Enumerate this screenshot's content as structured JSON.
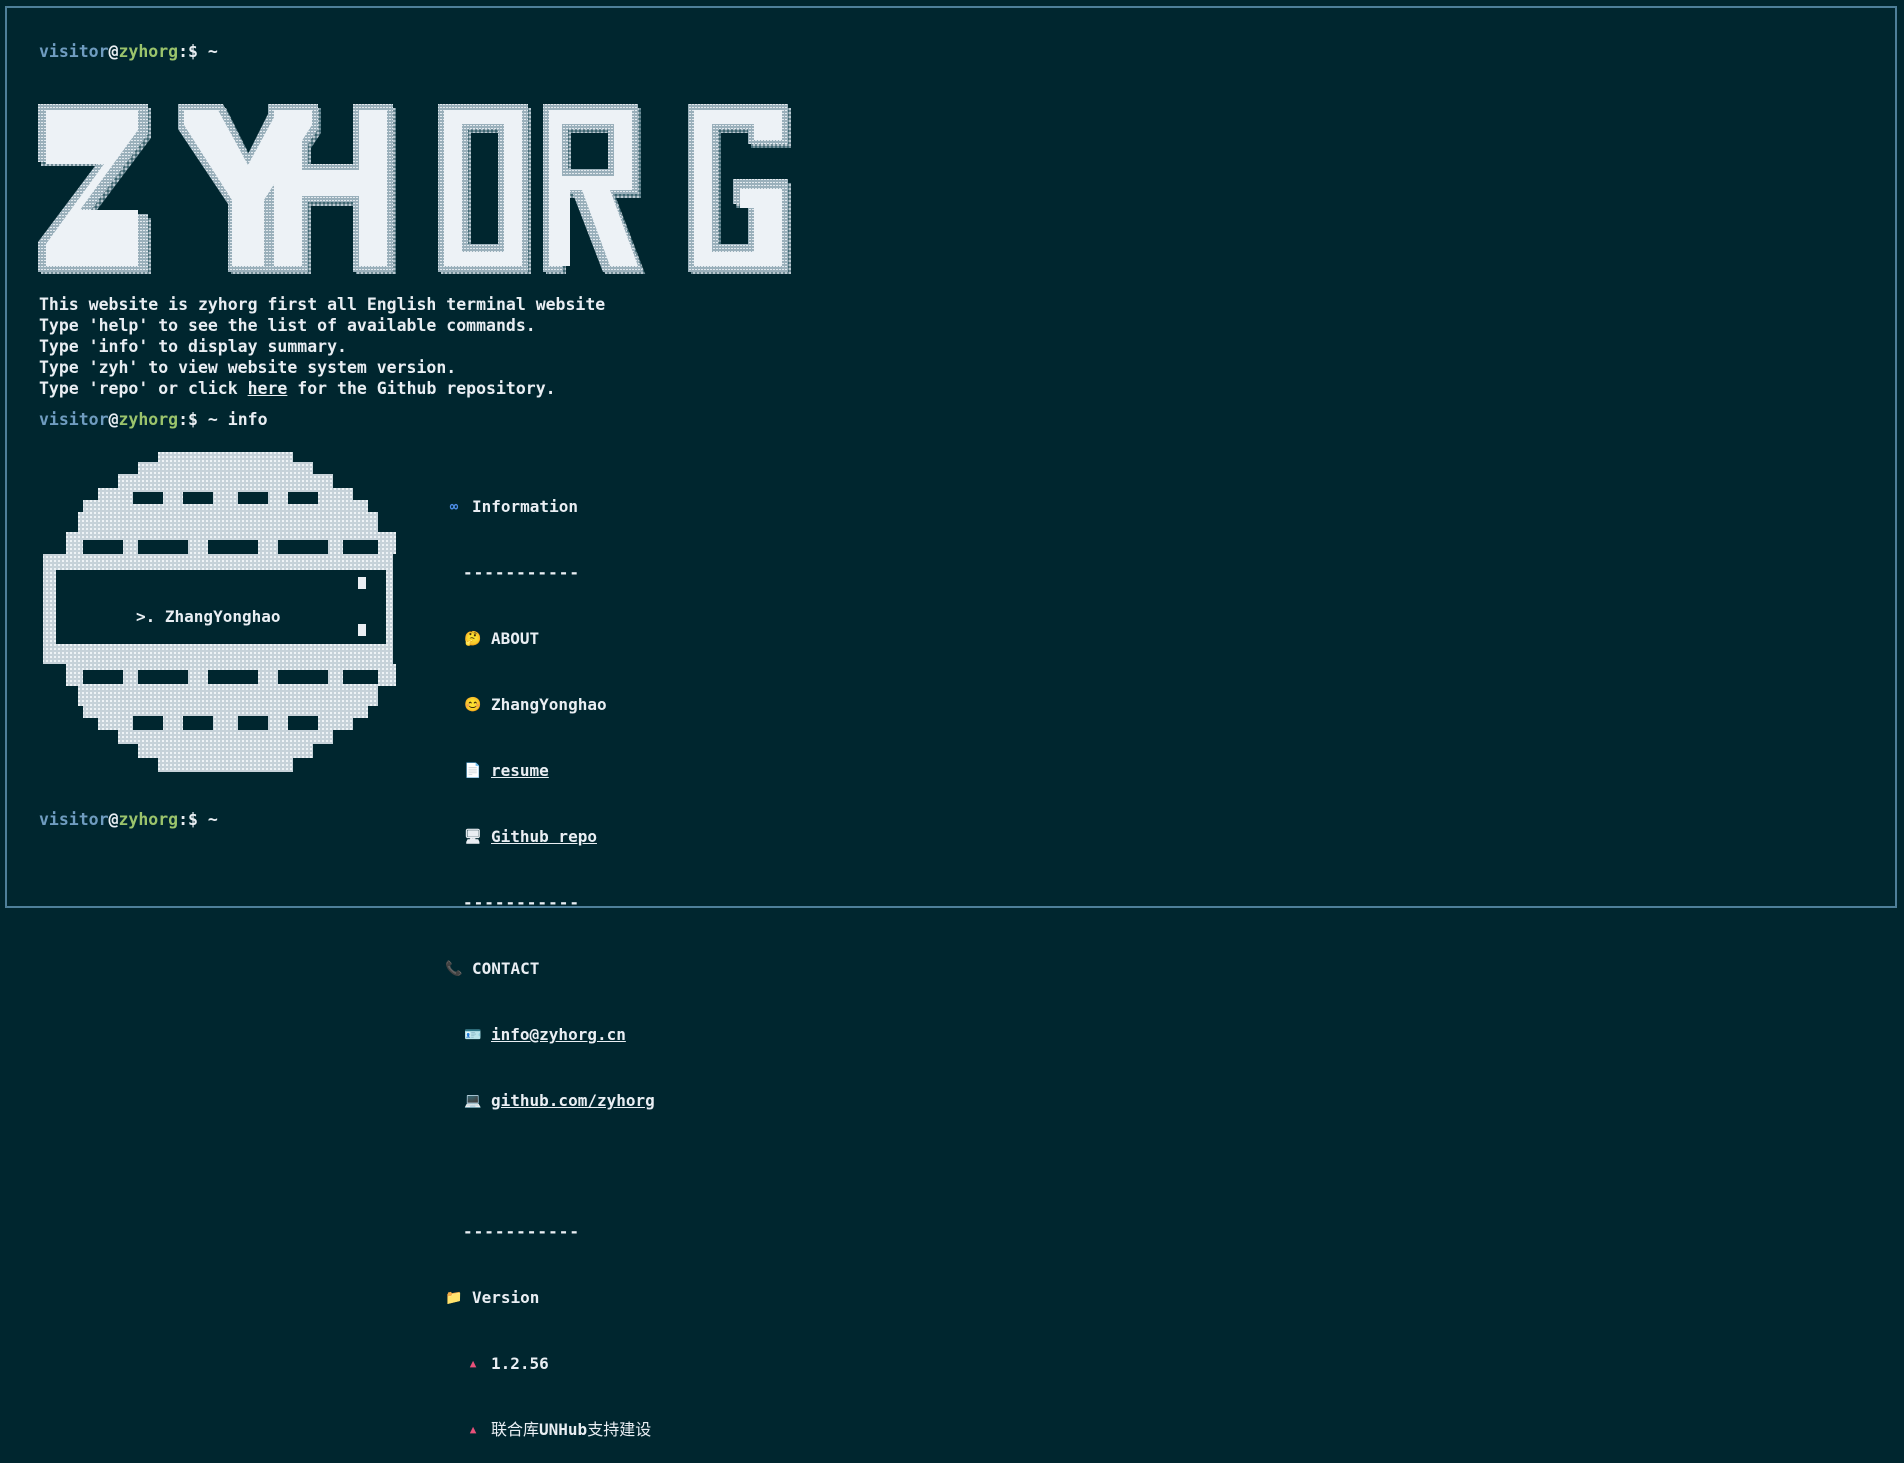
{
  "prompt": {
    "user": "visitor",
    "at": "@",
    "host": "zyhorg",
    "suffix": ":$ ~"
  },
  "commands": {
    "first": "",
    "second": "info",
    "third": ""
  },
  "banner": {
    "text": "ZYHORG"
  },
  "intro": {
    "line1": "This website is zyhorg first all English terminal website",
    "line2": "Type 'help' to see the list of available commands.",
    "line3": "Type 'info' to display summary.",
    "line4": "Type 'zyh' to view website system version.",
    "line5_prefix": "Type 'repo' or click ",
    "line5_link": "here",
    "line5_suffix": " for the Github repository."
  },
  "logo": {
    "text": ">. ZhangYonghao"
  },
  "info": {
    "information_icon": "infinity-icon",
    "information_label": "Information",
    "divider": "-----------",
    "about_label": "ABOUT",
    "about_icon": "thinking-face-icon",
    "name_label": "ZhangYonghao",
    "name_icon": "smiling-face-icon",
    "resume_label": "resume",
    "resume_icon": "document-icon",
    "github_repo_label": "Github repo",
    "github_repo_icon": "computer-icon",
    "contact_label": "CONTACT",
    "contact_icon": "phone-icon",
    "email_label": "info@zyhorg.cn",
    "email_icon": "id-card-icon",
    "github_link_label": "github.com/zyhorg",
    "github_link_icon": "laptop-icon",
    "version_label": "Version",
    "version_icon": "folder-icon",
    "version_number": "1.2.56",
    "hub_prefix": "联合库",
    "hub_bold": "UNHub",
    "hub_suffix": "支持建设"
  },
  "colors": {
    "background": "#00262f",
    "user": "#6f9cc0",
    "host": "#9bc46c",
    "text": "#e9eef3",
    "accent": "#e8517a",
    "border": "#4e7f9a"
  }
}
